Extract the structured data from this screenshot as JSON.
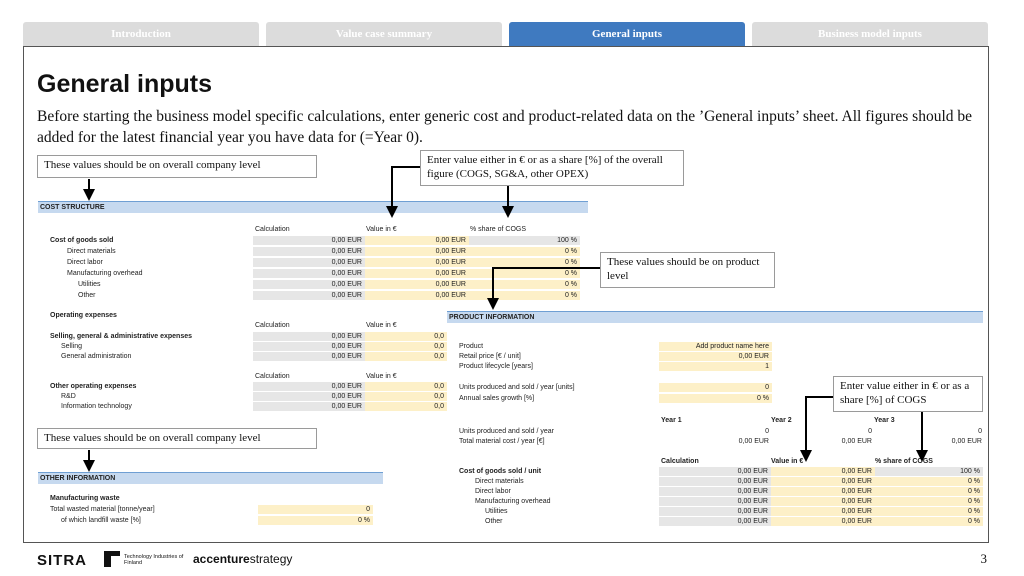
{
  "tabs": [
    {
      "label": "Introduction",
      "active": false
    },
    {
      "label": "Value case summary",
      "active": false
    },
    {
      "label": "General inputs",
      "active": true
    },
    {
      "label": "Business model inputs",
      "active": false
    }
  ],
  "page": {
    "title": "General inputs",
    "intro": "Before starting the business model specific calculations, enter generic cost and product-related data on the ’General inputs’ sheet. All figures should be added for the latest financial year you have data for (=Year 0)."
  },
  "notes": {
    "company_level_1": "These values should be on overall company level",
    "enter_value_share": "Enter value either in € or as a share [%] of the overall figure (COGS, SG&A, other OPEX)",
    "product_level": "These values should be on product level",
    "enter_value_cogs": "Enter value either in € or as a share [%] of COGS",
    "company_level_2": "These values should be on overall company level"
  },
  "cost_structure": {
    "header": "COST STRUCTURE",
    "col_calc": "Calculation",
    "col_value": "Value in €",
    "col_share": "% share of COGS",
    "cogs_title": "Cost of goods sold",
    "cogs_rows": [
      {
        "label": "Direct materials",
        "calc": "0,00 EUR",
        "value": "0,00 EUR",
        "share": "0 %"
      },
      {
        "label": "Direct labor",
        "calc": "0,00 EUR",
        "value": "0,00 EUR",
        "share": "0 %"
      },
      {
        "label": "Manufacturing overhead",
        "calc": "0,00 EUR",
        "value": "0,00 EUR",
        "share": "0 %"
      },
      {
        "label": "Utilities",
        "calc": "0,00 EUR",
        "value": "0,00 EUR",
        "share": "0 %"
      },
      {
        "label": "Other",
        "calc": "0,00 EUR",
        "value": "0,00 EUR",
        "share": "0 %"
      }
    ],
    "cogs_total": {
      "calc": "0,00 EUR",
      "value": "0,00 EUR",
      "share": "100 %"
    },
    "opex_title": "Operating expenses",
    "sga_title": "Selling, general & administrative expenses",
    "sga_total": {
      "calc": "0,00 EUR",
      "value": "0,0"
    },
    "sga_rows": [
      {
        "label": "Selling",
        "calc": "0,00 EUR",
        "value": "0,0"
      },
      {
        "label": "General administration",
        "calc": "0,00 EUR",
        "value": "0,0"
      }
    ],
    "other_title": "Other operating expenses",
    "other_total": {
      "calc": "0,00 EUR",
      "value": "0,0"
    },
    "other_rows": [
      {
        "label": "R&D",
        "calc": "0,00 EUR",
        "value": "0,0"
      },
      {
        "label": "Information technology",
        "calc": "0,00 EUR",
        "value": "0,0"
      }
    ]
  },
  "other_information": {
    "header": "OTHER INFORMATION",
    "title": "Manufacturing waste",
    "rows": [
      {
        "label": "Total wasted material [tonne/year]",
        "value": "0"
      },
      {
        "label": "of which landfill waste [%]",
        "value": "0 %"
      }
    ]
  },
  "product_information": {
    "header": "PRODUCT INFORMATION",
    "product_label": "Product",
    "product_value": "Add product name here",
    "retail_label": "Retail price [€ / unit]",
    "retail_value": "0,00 EUR",
    "lifecycle_label": "Product lifecycle [years]",
    "lifecycle_value": "1",
    "units_label": "Units produced and sold / year [units]",
    "units_value": "0",
    "growth_label": "Annual sales growth [%]",
    "growth_value": "0 %",
    "year_headers": [
      "Year 1",
      "Year 2",
      "Year 3"
    ],
    "units_year_label": "Units produced and sold / year",
    "units_year_values": [
      "0",
      "0",
      "0"
    ],
    "material_label": "Total material cost / year [€]",
    "material_values": [
      "0,00 EUR",
      "0,00 EUR",
      "0,00 EUR"
    ],
    "col_calc": "Calculation",
    "col_value": "Value in €",
    "col_share": "% share of COGS",
    "cogs_title": "Cost of goods sold / unit",
    "cogs_total": {
      "calc": "0,00 EUR",
      "value": "0,00 EUR",
      "share": "100 %"
    },
    "cogs_rows": [
      {
        "label": "Direct materials",
        "calc": "0,00 EUR",
        "value": "0,00 EUR",
        "share": "0 %"
      },
      {
        "label": "Direct labor",
        "calc": "0,00 EUR",
        "value": "0,00 EUR",
        "share": "0 %"
      },
      {
        "label": "Manufacturing overhead",
        "calc": "0,00 EUR",
        "value": "0,00 EUR",
        "share": "0 %"
      },
      {
        "label": "Utilities",
        "calc": "0,00 EUR",
        "value": "0,00 EUR",
        "share": "0 %"
      },
      {
        "label": "Other",
        "calc": "0,00 EUR",
        "value": "0,00 EUR",
        "share": "0 %"
      }
    ]
  },
  "footer": {
    "logo_sitra": "SITRA",
    "logo_tif": "Technology Industries of Finland",
    "logo_accenture_a": "accenture",
    "logo_accenture_b": "strategy",
    "page_number": "3"
  },
  "colors": {
    "tab_active": "#3f7ac0",
    "tab_inactive": "#dcdcdc",
    "header_fill": "#c6d9ef",
    "input_fill": "#fdf0c8",
    "calc_fill": "#e6e6e6"
  }
}
